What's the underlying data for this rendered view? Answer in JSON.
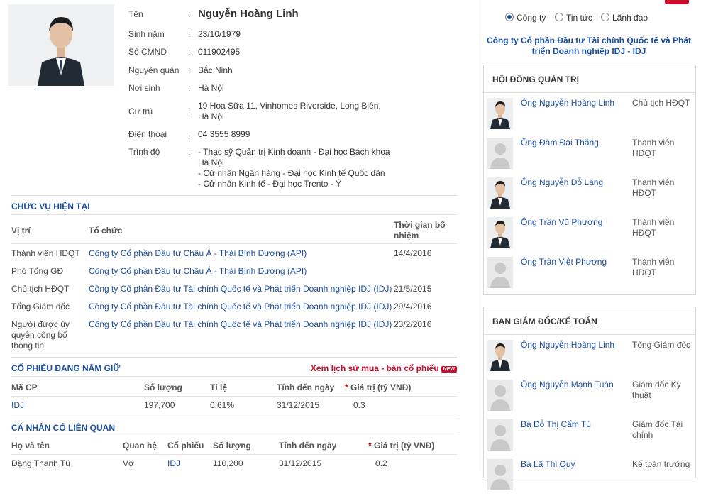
{
  "person": {
    "fields": [
      {
        "label": "Tên",
        "value": "Nguyễn Hoàng Linh"
      },
      {
        "label": "Sinh năm",
        "value": "23/10/1979"
      },
      {
        "label": "Số CMND",
        "value": "011902495"
      },
      {
        "label": "Nguyên quán",
        "value": "Bắc Ninh"
      },
      {
        "label": "Nơi sinh",
        "value": "Hà Nội"
      },
      {
        "label": "Cư trú",
        "value": "19 Hoa Sữa 11, Vinhomes Riverside, Long Biên, Hà Nội"
      },
      {
        "label": "Điện thoại",
        "value": "04 3555 8999"
      },
      {
        "label": "Trình độ",
        "value": "- Thạc sỹ Quản trị Kinh doanh - Đại học Bách khoa Hà Nội\n- Cử nhân Ngân hàng - Đại học Kinh tế Quốc dân\n- Cử nhân Kinh tế - Đại học Trento - Ý"
      }
    ]
  },
  "positions": {
    "title": "CHỨC VỤ HIỆN TẠI",
    "headers": [
      "Vị trí",
      "Tổ chức",
      "Thời gian bổ nhiệm"
    ],
    "rows": [
      {
        "role": "Thành viên HĐQT",
        "org": "Công ty Cổ phần Đầu tư Châu Á - Thái Bình Dương (API)",
        "date": "14/4/2016"
      },
      {
        "role": "Phó Tổng GĐ",
        "org": "Công ty Cổ phần Đầu tư Châu Á - Thái Bình Dương (API)",
        "date": ""
      },
      {
        "role": "Chủ tịch HĐQT",
        "org": "Công ty Cổ phần Đầu tư Tài chính Quốc tế và Phát triển Doanh nghiệp IDJ (IDJ)",
        "date": "21/5/2015"
      },
      {
        "role": "Tổng Giám đốc",
        "org": "Công ty Cổ phần Đầu tư Tài chính Quốc tế và Phát triển Doanh nghiệp IDJ (IDJ)",
        "date": "29/4/2016"
      },
      {
        "role": "Người được ủy quyền công bố thông tin",
        "org": "Công ty Cổ phần Đầu tư Tài chính Quốc tế và Phát triển Doanh nghiệp IDJ (IDJ)",
        "date": "23/2/2016"
      }
    ]
  },
  "shares": {
    "title": "CỔ PHIẾU ĐANG NẮM GIỮ",
    "history_link": "Xem lịch sử mua - bán cổ phiếu",
    "new_badge": "NEW",
    "headers": [
      "Mã CP",
      "Số lượng",
      "Tỉ lệ",
      "Tính đến ngày",
      "Giá trị (tỷ VNĐ)"
    ],
    "star": "*",
    "rows": [
      {
        "code": "IDJ",
        "qty": "197,700",
        "ratio": "0.61%",
        "date": "31/12/2015",
        "value": "0.3"
      }
    ]
  },
  "related": {
    "title": "CÁ NHÂN CÓ LIÊN QUAN",
    "headers": [
      "Họ và tên",
      "Quan hệ",
      "Cổ phiếu",
      "Số lượng",
      "Tính đến ngày",
      "Giá trị (tỷ VNĐ)"
    ],
    "star": "*",
    "rows": [
      {
        "name": "Đặng Thanh Tú",
        "relation": "Vợ",
        "code": "IDJ",
        "qty": "110,200",
        "date": "31/12/2015",
        "value": "0.2"
      }
    ]
  },
  "search_options": [
    {
      "label": "Công ty",
      "selected": true
    },
    {
      "label": "Tin tức",
      "selected": false
    },
    {
      "label": "Lãnh đạo",
      "selected": false
    }
  ],
  "company_name": "Công ty Cổ phần Đầu tư Tài chính Quốc tế và Phát triển Doanh nghiệp IDJ - IDJ",
  "board": {
    "title": "HỘI ĐỒNG QUẢN TRỊ",
    "members": [
      {
        "name": "Ông Nguyễn Hoàng Linh",
        "role": "Chủ tịch HĐQT",
        "photo": "suit"
      },
      {
        "name": "Ông Đàm Đại Thắng",
        "role": "Thành viên HĐQT",
        "photo": "placeholder"
      },
      {
        "name": "Ông Nguyễn Đỗ Lăng",
        "role": "Thành viên HĐQT",
        "photo": "suit"
      },
      {
        "name": "Ông Trần Vũ Phương",
        "role": "Thành viên HĐQT",
        "photo": "suit"
      },
      {
        "name": "Ông Trần Việt Phương",
        "role": "Thành viên HĐQT",
        "photo": "placeholder"
      }
    ]
  },
  "management": {
    "title": "BAN GIÁM ĐỐC/KẾ TOÁN",
    "members": [
      {
        "name": "Ông Nguyễn Hoàng Linh",
        "role": "Tổng Giám đốc",
        "photo": "suit"
      },
      {
        "name": "Ông Nguyễn Mạnh Tuân",
        "role": "Giám đốc Kỹ thuật",
        "photo": "placeholder"
      },
      {
        "name": "Bà Đỗ Thị Cẩm Tú",
        "role": "Giám đốc Tài chính",
        "photo": "placeholder"
      },
      {
        "name": "Bà Lã Thị Quy",
        "role": "Kế toán trưởng",
        "photo": "placeholder"
      }
    ]
  },
  "colors": {
    "link": "#1a4e9e",
    "accent_red": "#c8102e"
  }
}
